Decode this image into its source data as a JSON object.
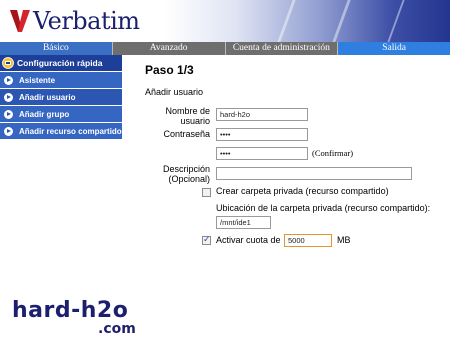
{
  "brand": {
    "name": "Verbatim"
  },
  "nav": {
    "tabs": [
      "Básico",
      "Avanzado",
      "Cuenta de administración",
      "Salida"
    ]
  },
  "sidebar": {
    "header": "Configuración rápida",
    "items": [
      {
        "label": "Asistente"
      },
      {
        "label": "Añadir usuario"
      },
      {
        "label": "Añadir grupo"
      },
      {
        "label": "Añadir recurso compartido"
      }
    ]
  },
  "main": {
    "step": "Paso 1/3",
    "section": "Añadir usuario",
    "username_label_1": "Nombre de",
    "username_label_2": "usuario",
    "username_value": "hard-h2o",
    "password_label": "Contraseña",
    "password_value": "••••",
    "confirm_value": "••••",
    "confirm_label": "(Confirmar)",
    "desc_label_1": "Descripción",
    "desc_label_2": "(Opcional)",
    "desc_value": "",
    "private_folder_label": "Crear carpeta privada (recurso compartido)",
    "private_folder_checked": false,
    "location_label": "Ubicación de la carpeta privada (recurso compartido):",
    "location_value": "/mnt/ide1",
    "quota_label": "Activar cuota de",
    "quota_checked": true,
    "quota_value": "5000",
    "quota_unit": "MB"
  },
  "watermark": {
    "line1": "hard-h2o",
    "line2": ".com"
  },
  "colors": {
    "brand_navy": "#1a1f6e",
    "sidebar_blue": "#3566c2",
    "active_tab": "#3a6fc4"
  }
}
